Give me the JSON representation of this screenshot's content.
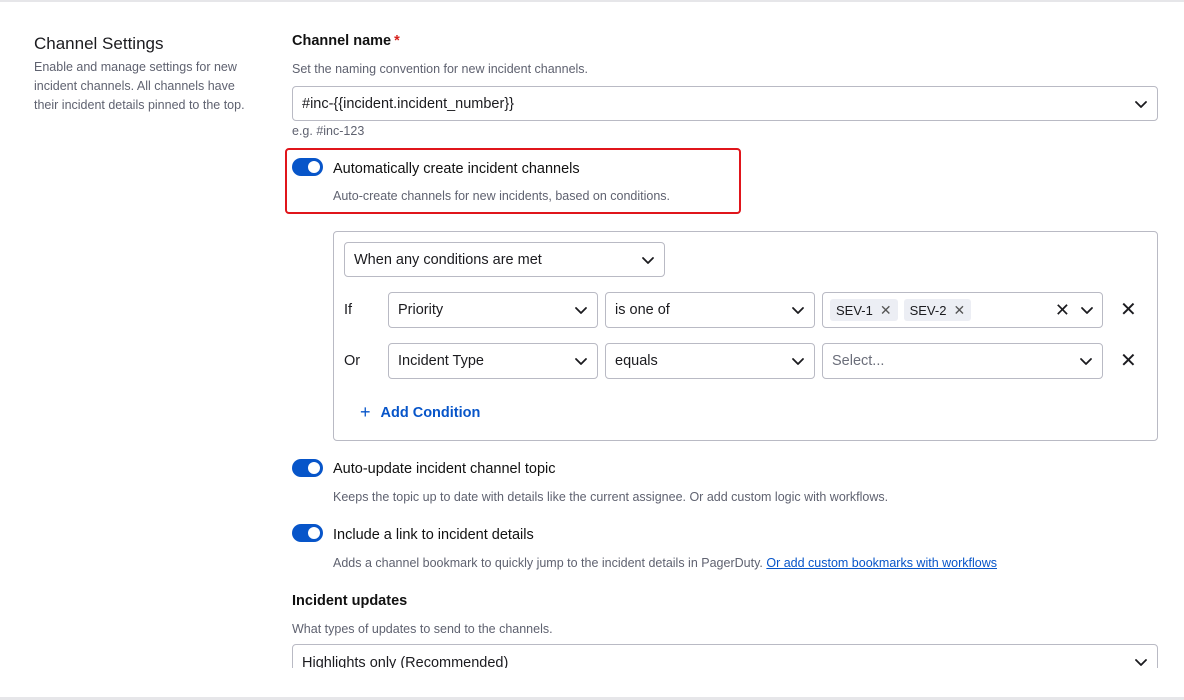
{
  "left": {
    "title": "Channel Settings",
    "description": "Enable and manage settings for new incident channels. All channels have their incident details pinned to the top."
  },
  "channel_name": {
    "label": "Channel name",
    "required_mark": "*",
    "help": "Set the naming convention for new incident channels.",
    "value": "#inc-{{incident.incident_number}}",
    "example": "e.g. #inc-123"
  },
  "auto_create": {
    "label": "Automatically create incident channels",
    "description": "Auto-create channels for new incidents, based on conditions.",
    "enabled": true
  },
  "conditions": {
    "match_mode": "When any conditions are met",
    "rows": [
      {
        "connector": "If",
        "field": "Priority",
        "operator": "is one of",
        "tags": [
          "SEV-1",
          "SEV-2"
        ],
        "tag_remove_glyph": "✕",
        "clear_glyph": "✕",
        "remove_glyph": "✕"
      },
      {
        "connector": "Or",
        "field": "Incident Type",
        "operator": "equals",
        "placeholder": "Select...",
        "remove_glyph": "✕"
      }
    ],
    "add_label": "Add Condition",
    "add_glyph": "+"
  },
  "auto_update_topic": {
    "label": "Auto-update incident channel topic",
    "description": "Keeps the topic up to date with details like the current assignee. Or add custom logic with workflows.",
    "enabled": true
  },
  "include_link": {
    "label": "Include a link to incident details",
    "description": "Adds a channel bookmark to quickly jump to the incident details in PagerDuty.",
    "link_text": "Or add custom bookmarks with workflows",
    "enabled": true
  },
  "incident_updates": {
    "label": "Incident updates",
    "help": "What types of updates to send to the channels.",
    "value": "Highlights only (Recommended)"
  },
  "colors": {
    "accent": "#0755c9",
    "highlight": "#e0151b",
    "required": "#d6201b"
  },
  "icons": {
    "chevron": "chevron-down-icon",
    "close": "close-icon",
    "plus": "plus-icon"
  }
}
